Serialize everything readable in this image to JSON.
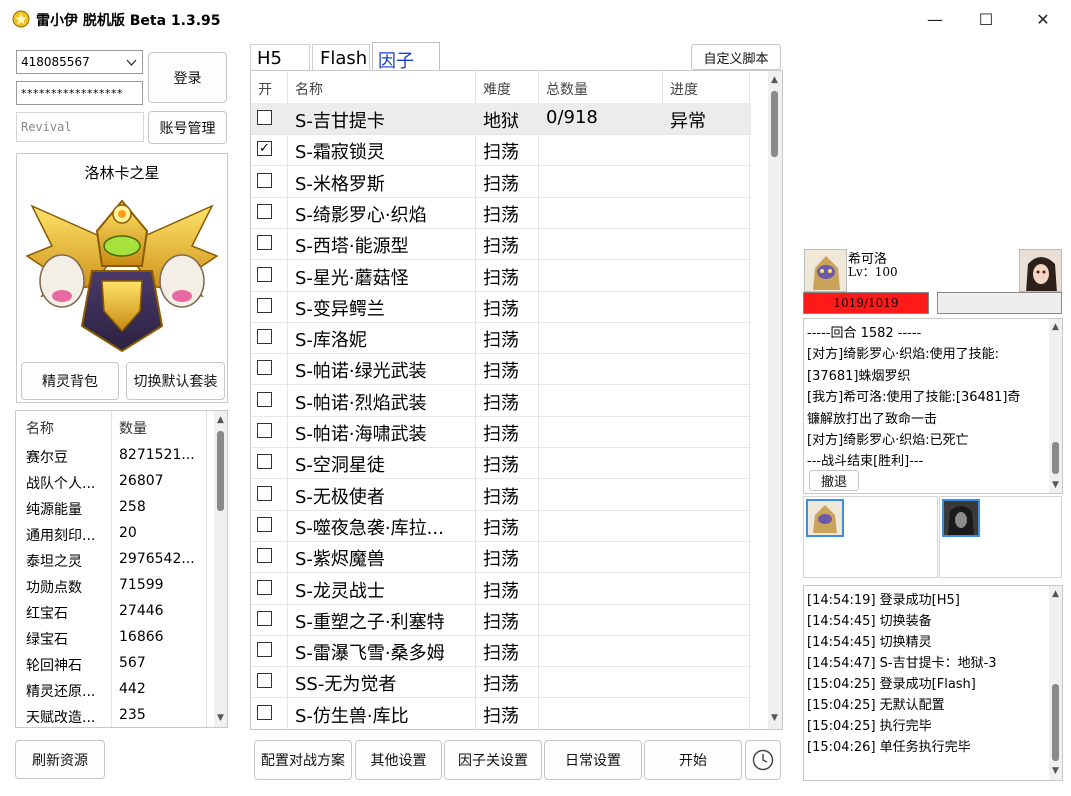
{
  "window": {
    "title": "雷小伊 脱机版 Beta 1.3.95",
    "minimize": "—",
    "maximize": "☐",
    "close": "✕"
  },
  "account": {
    "id_value": "418085567",
    "password_value": "*****************",
    "revival_placeholder": "Revival",
    "login_label": "登录",
    "manage_label": "账号管理"
  },
  "pet": {
    "name": "洛林卡之星",
    "bag_label": "精灵背包",
    "switch_label": "切换默认套装"
  },
  "resources": {
    "headers": [
      "名称",
      "数量"
    ],
    "rows": [
      [
        "赛尔豆",
        "8271521..."
      ],
      [
        "战队个人...",
        "26807"
      ],
      [
        "纯源能量",
        "258"
      ],
      [
        "通用刻印...",
        "20"
      ],
      [
        "泰坦之灵",
        "2976542..."
      ],
      [
        "功勋点数",
        "71599"
      ],
      [
        "红宝石",
        "27446"
      ],
      [
        "绿宝石",
        "16866"
      ],
      [
        "轮回神石",
        "567"
      ],
      [
        "精灵还原...",
        "442"
      ],
      [
        "天赋改造...",
        "235"
      ]
    ],
    "refresh_label": "刷新资源"
  },
  "tabs": [
    "H5",
    "Flash",
    "因子"
  ],
  "custom_script_label": "自定义脚本",
  "factor_table": {
    "headers": [
      "开",
      "名称",
      "难度",
      "总数量",
      "进度"
    ],
    "rows": [
      {
        "checked": "",
        "name": "S-吉甘提卡",
        "difficulty": "地狱",
        "total": "0/918",
        "progress": "异常"
      },
      {
        "checked": "✓",
        "name": "S-霜寂锁灵",
        "difficulty": "扫荡",
        "total": "",
        "progress": ""
      },
      {
        "checked": "",
        "name": "S-米格罗斯",
        "difficulty": "扫荡",
        "total": "",
        "progress": ""
      },
      {
        "checked": "",
        "name": "S-绮影罗心·织焰",
        "difficulty": "扫荡",
        "total": "",
        "progress": ""
      },
      {
        "checked": "",
        "name": "S-西塔·能源型",
        "difficulty": "扫荡",
        "total": "",
        "progress": ""
      },
      {
        "checked": "",
        "name": "S-星光·蘑菇怪",
        "difficulty": "扫荡",
        "total": "",
        "progress": ""
      },
      {
        "checked": "",
        "name": "S-变异鳄兰",
        "difficulty": "扫荡",
        "total": "",
        "progress": ""
      },
      {
        "checked": "",
        "name": "S-库洛妮",
        "difficulty": "扫荡",
        "total": "",
        "progress": ""
      },
      {
        "checked": "",
        "name": "S-帕诺·绿光武装",
        "difficulty": "扫荡",
        "total": "",
        "progress": ""
      },
      {
        "checked": "",
        "name": "S-帕诺·烈焰武装",
        "difficulty": "扫荡",
        "total": "",
        "progress": ""
      },
      {
        "checked": "",
        "name": "S-帕诺·海啸武装",
        "difficulty": "扫荡",
        "total": "",
        "progress": ""
      },
      {
        "checked": "",
        "name": "S-空洞星徒",
        "difficulty": "扫荡",
        "total": "",
        "progress": ""
      },
      {
        "checked": "",
        "name": "S-无极使者",
        "difficulty": "扫荡",
        "total": "",
        "progress": ""
      },
      {
        "checked": "",
        "name": "S-噬夜急袭·库拉...",
        "difficulty": "扫荡",
        "total": "",
        "progress": ""
      },
      {
        "checked": "",
        "name": "S-紫烬魔兽",
        "difficulty": "扫荡",
        "total": "",
        "progress": ""
      },
      {
        "checked": "",
        "name": "S-龙灵战士",
        "difficulty": "扫荡",
        "total": "",
        "progress": ""
      },
      {
        "checked": "",
        "name": "S-重塑之子·利塞特",
        "difficulty": "扫荡",
        "total": "",
        "progress": ""
      },
      {
        "checked": "",
        "name": "S-雷瀑飞雪·桑多姆",
        "difficulty": "扫荡",
        "total": "",
        "progress": ""
      },
      {
        "checked": "",
        "name": "SS-无为觉者",
        "difficulty": "扫荡",
        "total": "",
        "progress": ""
      },
      {
        "checked": "",
        "name": "S-仿生兽·库比",
        "difficulty": "扫荡",
        "total": "",
        "progress": ""
      }
    ]
  },
  "bottom_buttons": {
    "battle_plan": "配置对战方案",
    "other_settings": "其他设置",
    "factor_settings": "因子关设置",
    "daily_settings": "日常设置",
    "start": "开始"
  },
  "battle": {
    "player_name": "希可洛",
    "player_level": "Lv：100",
    "player_hp": "1019/1019",
    "player_hp_fraction": 1.0,
    "enemy_hp_fraction": 0.0,
    "log": [
      "-----回合 1582 -----",
      "[对方]绮影罗心·织焰:使用了技能:",
      "[37681]蛛烟罗织",
      "[我方]希可洛:使用了技能:[36481]奇",
      "镰解放打出了致命一击",
      "[对方]绮影罗心·织焰:已死亡",
      "---战斗结束[胜利]---"
    ],
    "retreat_label": "撤退"
  },
  "system_log": [
    "[14:54:19] 登录成功[H5]",
    "[14:54:45] 切换装备",
    "[14:54:45] 切换精灵",
    "[14:54:47] S-吉甘提卡：地狱-3",
    "[15:04:25] 登录成功[Flash]",
    "[15:04:25] 无默认配置",
    "[15:04:25]  执行完毕",
    "[15:04:26] 单任务执行完毕"
  ],
  "colors": {
    "hp_red": "#ff1a1a",
    "tab_active_text": "#1a3fd1",
    "row_selected": "#ececec"
  },
  "icons": {
    "app": "star-badge-icon",
    "timer": "clock-icon"
  }
}
